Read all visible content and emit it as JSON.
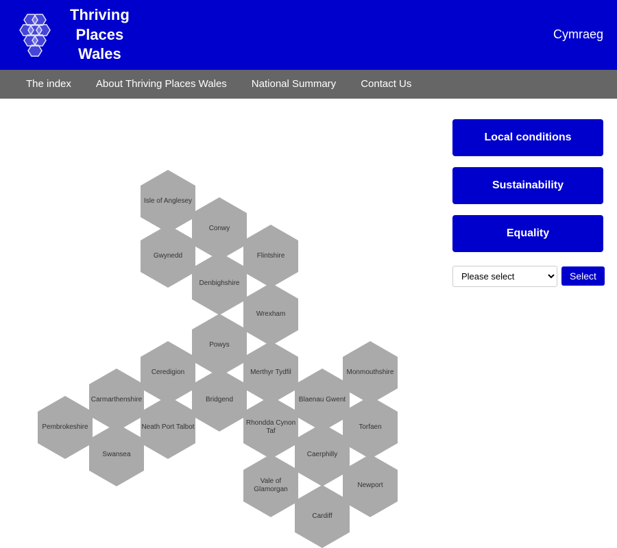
{
  "header": {
    "title_line1": "Thriving",
    "title_line2": "Places",
    "title_line3": "Wales",
    "cymraeg": "Cymraeg"
  },
  "nav": {
    "items": [
      {
        "label": "The index",
        "id": "nav-index"
      },
      {
        "label": "About Thriving Places Wales",
        "id": "nav-about"
      },
      {
        "label": "National Summary",
        "id": "nav-summary"
      },
      {
        "label": "Contact Us",
        "id": "nav-contact"
      }
    ]
  },
  "sidebar": {
    "local_conditions": "Local conditions",
    "sustainability": "Sustainability",
    "equality": "Equality",
    "select_placeholder": "Please select",
    "select_button": "Select"
  },
  "hexagons": [
    {
      "label": "Isle of Anglesey",
      "col": 2,
      "row": 0
    },
    {
      "label": "Conwy",
      "col": 3,
      "row": 1
    },
    {
      "label": "Gwynedd",
      "col": 2,
      "row": 2
    },
    {
      "label": "Flintshire",
      "col": 4,
      "row": 2
    },
    {
      "label": "Denbighshire",
      "col": 3,
      "row": 3
    },
    {
      "label": "Wrexham",
      "col": 4,
      "row": 4
    },
    {
      "label": "Powys",
      "col": 3,
      "row": 5
    },
    {
      "label": "Ceredigion",
      "col": 2,
      "row": 6
    },
    {
      "label": "Merthyr Tydfil",
      "col": 4,
      "row": 6
    },
    {
      "label": "Monmouthshire",
      "col": 6,
      "row": 6
    },
    {
      "label": "Carmarthenshire",
      "col": 1,
      "row": 7
    },
    {
      "label": "Bridgend",
      "col": 3,
      "row": 7
    },
    {
      "label": "Blaenau Gwent",
      "col": 5,
      "row": 7
    },
    {
      "label": "Pembrokeshire",
      "col": 0,
      "row": 8
    },
    {
      "label": "Neath Port Talbot",
      "col": 2,
      "row": 8
    },
    {
      "label": "Rhondda Cynon Taf",
      "col": 4,
      "row": 8
    },
    {
      "label": "Torfaen",
      "col": 6,
      "row": 8
    },
    {
      "label": "Swansea",
      "col": 1,
      "row": 9
    },
    {
      "label": "Caerphilly",
      "col": 5,
      "row": 9
    },
    {
      "label": "Vale of Glamorgan",
      "col": 4,
      "row": 10
    },
    {
      "label": "Newport",
      "col": 6,
      "row": 10
    },
    {
      "label": "Cardiff",
      "col": 5,
      "row": 11
    }
  ],
  "select_options": [
    "Isle of Anglesey",
    "Conwy",
    "Gwynedd",
    "Flintshire",
    "Denbighshire",
    "Wrexham",
    "Powys",
    "Ceredigion",
    "Merthyr Tydfil",
    "Monmouthshire",
    "Carmarthenshire",
    "Bridgend",
    "Blaenau Gwent",
    "Pembrokeshire",
    "Neath Port Talbot",
    "Rhondda Cynon Taf",
    "Torfaen",
    "Swansea",
    "Caerphilly",
    "Vale of Glamorgan",
    "Newport",
    "Cardiff"
  ]
}
